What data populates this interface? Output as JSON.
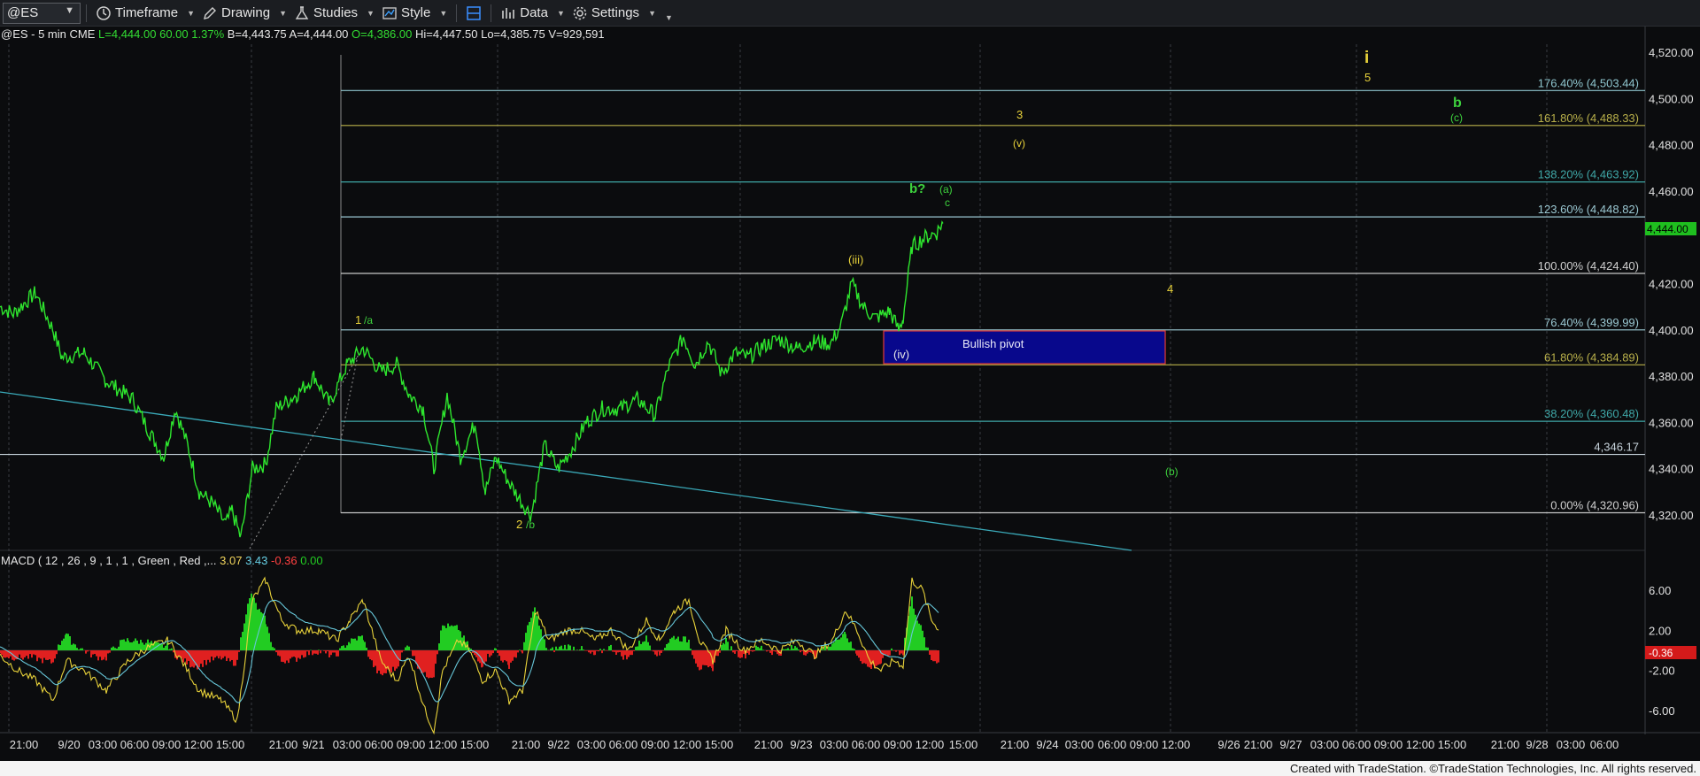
{
  "toolbar": {
    "symbol": "@ES",
    "timeframe_label": "Timeframe",
    "drawing_label": "Drawing",
    "studies_label": "Studies",
    "style_label": "Style",
    "data_label": "Data",
    "settings_label": "Settings"
  },
  "status": {
    "instrument": "@ES - 5 min",
    "exchange": "CME",
    "last": "L=4,444.00",
    "change": "60.00",
    "pct": "1.37%",
    "bid": "B=4,443.75",
    "ask": "A=4,444.00",
    "open": "O=4,386.00",
    "high": "Hi=4,447.50",
    "low": "Lo=4,385.75",
    "volume": "V=929,591"
  },
  "macd": {
    "title": "MACD ( 12 , 26 , 9 , 1 , 1 , Green , Red ,...",
    "macd_value": "3.07",
    "signal_value": "3.43",
    "diff_value": "-0.36",
    "zero_value": "0.00"
  },
  "price_axis": [
    "4,520.00",
    "4,500.00",
    "4,480.00",
    "4,460.00",
    "4,420.00",
    "4,400.00",
    "4,380.00",
    "4,360.00",
    "4,340.00",
    "4,320.00"
  ],
  "last_price_tag": "4,444.00",
  "macd_axis": [
    "6.00",
    "2.00",
    "-2.00",
    "-6.00"
  ],
  "macd_tag": "-0.36",
  "fib_levels": [
    {
      "label": "176.40% (4,503.44)",
      "color": "#8fc6cf"
    },
    {
      "label": "161.80% (4,488.33)",
      "color": "#b9b04a"
    },
    {
      "label": "138.20% (4,463.92)",
      "color": "#3fa7a7"
    },
    {
      "label": "123.60% (4,448.82)",
      "color": "#9bc8d2"
    },
    {
      "label": "100.00% (4,424.40)",
      "color": "#c8c8c8"
    },
    {
      "label": "76.40% (4,399.99)",
      "color": "#9bc8d2"
    },
    {
      "label": "61.80% (4,384.89)",
      "color": "#b9b04a"
    },
    {
      "label": "38.20% (4,360.48)",
      "color": "#3fa7a7"
    },
    {
      "label": "4,346.17",
      "color": "#c8d4dc"
    },
    {
      "label": "0.00% (4,320.96)",
      "color": "#c8c8c8"
    }
  ],
  "annotations": {
    "pivot": "Bullish pivot",
    "w_1a": "1",
    "w_1a_suffix": "/a",
    "w_2b": "2",
    "w_2b_suffix": "/b",
    "w_iii": "(iii)",
    "w_iv": "(iv)",
    "w_bq": "b?",
    "w_a": "(a)",
    "w_c": "c",
    "w_3": "3",
    "w_v": "(v)",
    "w_4": "4",
    "w_b_paren": "(b)",
    "w_i": "i",
    "w_5": "5",
    "w_b": "b",
    "w_c_paren": "(c)"
  },
  "time_axis": [
    "21:00",
    "9/20",
    "03:00",
    "06:00",
    "09:00",
    "12:00",
    "15:00",
    "21:00",
    "9/21",
    "03:00",
    "06:00",
    "09:00",
    "12:00",
    "15:00",
    "21:00",
    "9/22",
    "03:00",
    "06:00",
    "09:00",
    "12:00",
    "15:00",
    "21:00",
    "9/23",
    "03:00",
    "06:00",
    "09:00",
    "12:00",
    "15:00",
    "21:00",
    "9/24",
    "03:00",
    "06:00",
    "09:00",
    "12:00",
    "9/26",
    "21:00",
    "9/27",
    "03:00",
    "06:00",
    "09:00",
    "12:00",
    "15:00",
    "21:00",
    "9/28",
    "03:00",
    "06:00"
  ],
  "footer": "Created with TradeStation. ©TradeStation Technologies, Inc. All rights reserved.",
  "colors": {
    "price_green": "#2ee62e",
    "pivot_fill": "#08088c",
    "pivot_border": "#e43a3a",
    "wave_yellow": "#e8d23a",
    "wave_green": "#3dd23d",
    "trend_line": "#3aa9b8"
  }
}
